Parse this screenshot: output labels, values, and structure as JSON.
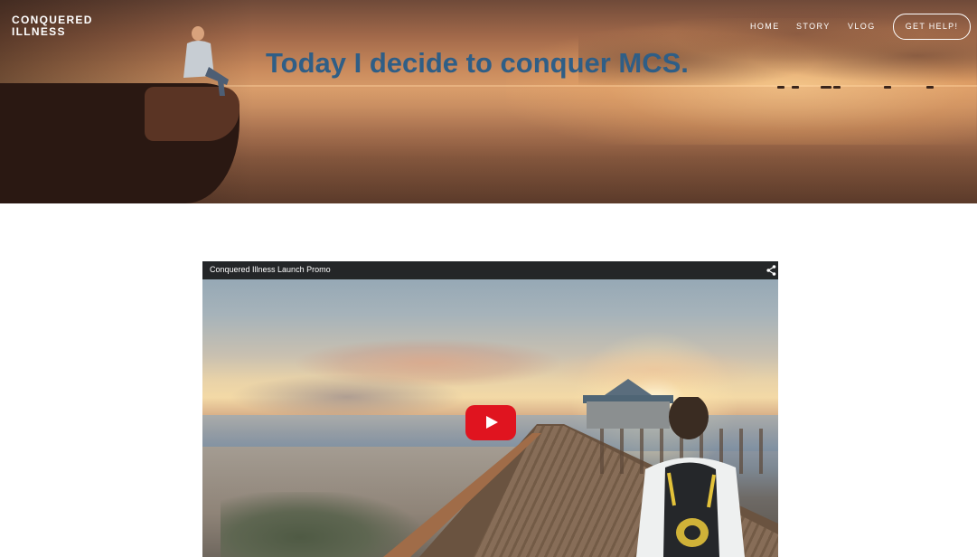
{
  "header": {
    "brand_line1": "CONQUERED",
    "brand_line2": "ILLNESS",
    "nav": {
      "home": "HOME",
      "story": "STORY",
      "vlog": "VLOG"
    },
    "cta_label": "GET HELP!"
  },
  "hero": {
    "headline": "Today I decide to conquer MCS."
  },
  "video": {
    "title": "Conquered Illness Launch Promo",
    "share_icon": "share-icon",
    "play_icon": "play-icon"
  },
  "colors": {
    "headline": "#2f5e86",
    "play_button": "#e0141f",
    "video_title_bar": "#141414",
    "page_background": "#ffffff"
  }
}
